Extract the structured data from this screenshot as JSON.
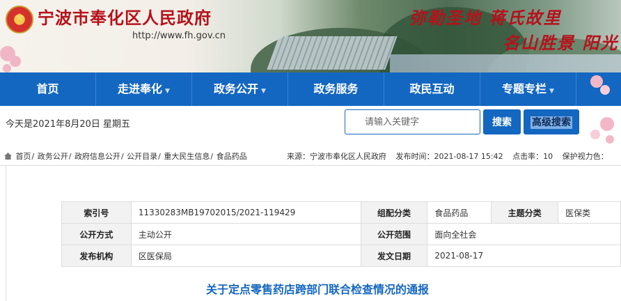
{
  "header": {
    "site_title": "宁波市奉化区人民政府",
    "site_url": "http://www.fh.gov.cn",
    "slogan_line1": "弥勒圣地  蒋氏故里",
    "slogan_line2": "名山胜景  阳光"
  },
  "nav": {
    "items": [
      {
        "label": "首页",
        "has_dropdown": false
      },
      {
        "label": "走进奉化",
        "has_dropdown": true
      },
      {
        "label": "政务公开",
        "has_dropdown": true
      },
      {
        "label": "政务服务",
        "has_dropdown": false
      },
      {
        "label": "政民互动",
        "has_dropdown": false
      },
      {
        "label": "专题专栏",
        "has_dropdown": true
      }
    ],
    "caret": "▼"
  },
  "toolbar": {
    "date_text": "今天是2021年8月20日  星期五",
    "search_placeholder": "请输入关键字",
    "search_label": "搜索",
    "advanced_label": "高级搜索"
  },
  "breadcrumb": {
    "items": [
      "首页",
      "政务公开",
      "政府信息公开",
      "公开目录",
      "重大民生信息",
      "食品药品"
    ],
    "separator": "/"
  },
  "meta": {
    "source_label": "来源：",
    "source_value": "宁波市奉化区人民政府",
    "publish_label": "发布时间：",
    "publish_value": "2021-08-17 15:42",
    "clicks_label": "点击率：",
    "clicks_value": "10",
    "eye_label": "保护视力色："
  },
  "info_table": {
    "index_label": "索引号",
    "index_value": "11330283MB19702015/2021-119429",
    "category_label": "组配分类",
    "category_value": "食品药品",
    "topic_label": "主题分类",
    "topic_value": "医保类",
    "method_label": "公开方式",
    "method_value": "主动公开",
    "scope_label": "公开范围",
    "scope_value": "面向全社会",
    "org_label": "发布机构",
    "org_value": "区医保局",
    "date_label": "发文日期",
    "date_value": "2021-08-17"
  },
  "document": {
    "title": "关于定点零售药店跨部门联合检查情况的通报"
  },
  "colors": {
    "nav_blue": "#1467c1",
    "title_red": "#b5121b",
    "label_bg": "#f2f2f2"
  }
}
